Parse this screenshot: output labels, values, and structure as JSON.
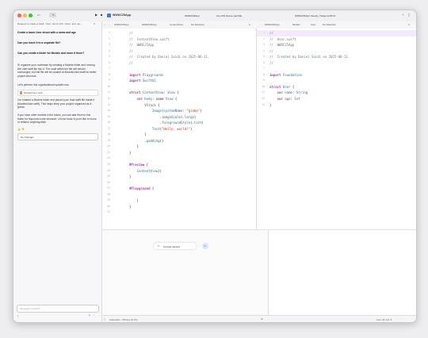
{
  "window": {
    "project_name": "WWDC25App",
    "breadcrumb_project": "WWDC25App",
    "device": "Any iOS Device (arm64)",
    "status": "WWDC25App: Ready | Today at 08:14"
  },
  "sidebar": {
    "thread_title": "Request to create a basic `User` struct with `name` and `ag…",
    "q1": "Create a basic User struct with a name and age",
    "q2": "Can you move it to a separate file?",
    "q3": "Can you create a folder for Models and move it there?",
    "answer1": "I'll organize your codebase by creating a Models folder and moving the User.swift file into it. The code within the file will remain unchanged, but the file will be located at Models/User.swift for better project structure.",
    "answer2": "Let's perform this organizational update now.",
    "file_chip": "Models/User.swift",
    "answer3": "I've created a Models folder and placed your User.swift file inside it (Models/User.swift). This helps keep your project organized as it grows.",
    "answer4": "If you have other models in the future, you can add them to this folder for improved code structure. Let me know if you'd like to move or refactor anything else!",
    "changes": "No Changes",
    "message_placeholder": "Message ChatGPT"
  },
  "editor_left": {
    "breadcrumb": [
      "WWDC25App",
      "WWDC25App",
      "ContentView",
      "No Selection"
    ],
    "lines": [
      "//",
      "//  ContentView.swift",
      "//  WWDC25App",
      "//",
      "//  Created by Daniel Saidi on 2025-06-11.",
      "//",
      "",
      "import Playgrounds",
      "import SwiftUI",
      "",
      "struct ContentView: View {",
      "    var body: some View {",
      "        VStack {",
      "            Image(systemName: \"globe\")",
      "                .imageScale(.large)",
      "                .foregroundStyle(.tint)",
      "            Text(\"Hello, world!\")",
      "        }",
      "        .padding()",
      "    }",
      "}",
      "",
      "#Preview {",
      "    ContentView()",
      "}",
      "",
      "#Playground {",
      "",
      "    |",
      "}",
      ""
    ],
    "canvas_status": "Canvas paused"
  },
  "editor_right": {
    "breadcrumb": [
      "WWDC25App",
      "Models",
      "User",
      "No Selection"
    ],
    "lines": [
      "//",
      "//  User.swift",
      "//  WWDC25App",
      "//",
      "//  Created by Daniel Saidi on 2025-06-11.",
      "//",
      "",
      "import Foundation",
      "",
      "struct User {",
      "    var name: String",
      "    var age: Int",
      "}"
    ]
  },
  "statusbar": {
    "left": "Automatic – iPhone 16 Pro",
    "right": "Line: 21  Col: 5"
  },
  "colors": {
    "accent": "#2f7cf6",
    "comment": "#6c7986",
    "keyword": "#ad3da4",
    "string": "#d12f1b"
  }
}
